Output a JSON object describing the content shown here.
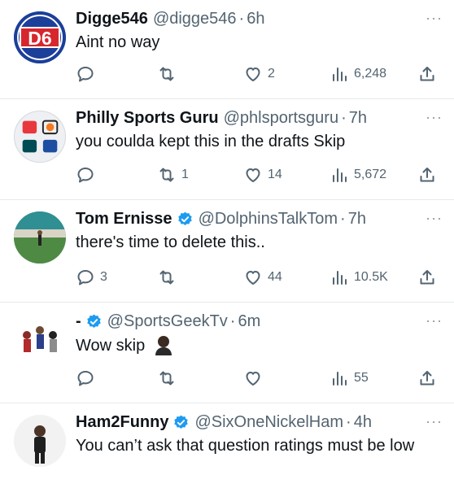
{
  "tweets": [
    {
      "name": "Digge546",
      "verified": false,
      "handle": "@digge546",
      "time": "6h",
      "text": "Aint no way",
      "avatar_text": "D6",
      "replies": "",
      "retweets": "",
      "likes": "2",
      "views": "6,248"
    },
    {
      "name": "Philly Sports Guru",
      "verified": false,
      "handle": "@phlsportsguru",
      "time": "7h",
      "text": "you coulda kept this in the drafts Skip",
      "replies": "",
      "retweets": "1",
      "likes": "14",
      "views": "5,672"
    },
    {
      "name": "Tom Ernisse",
      "verified": true,
      "handle": "@DolphinsTalkTom",
      "time": "7h",
      "text": "there's time to delete this..",
      "replies": "3",
      "retweets": "",
      "likes": "44",
      "views": "10.5K"
    },
    {
      "name": "-",
      "verified": true,
      "handle": "@SportsGeekTv",
      "time": "6m",
      "text": "Wow skip",
      "replies": "",
      "retweets": "",
      "likes": "",
      "views": "55"
    },
    {
      "name": "Ham2Funny",
      "verified": true,
      "handle": "@SixOneNickelHam",
      "time": "4h",
      "text": "You can’t ask that question ratings must be low"
    }
  ],
  "ui": {
    "separator": "·",
    "more": "···"
  },
  "colors": {
    "verified": "#1d9bf0",
    "secondary_text": "#536471",
    "divider": "#e6e9eb"
  }
}
